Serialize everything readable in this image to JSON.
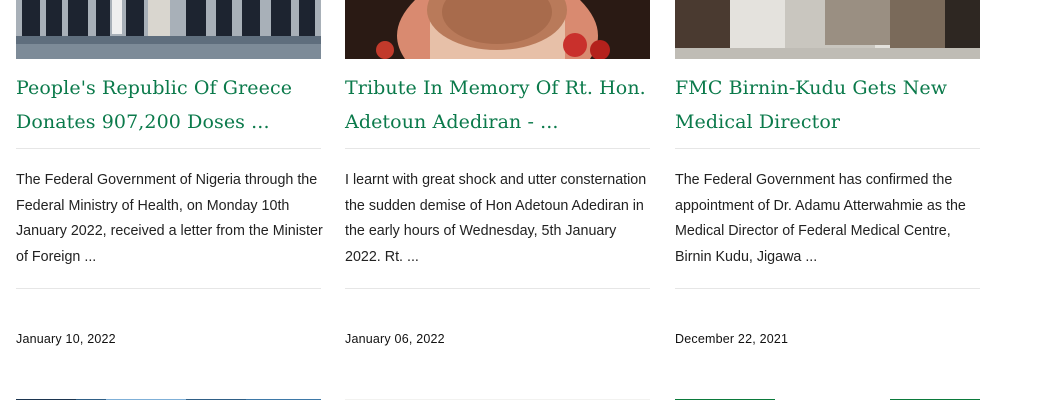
{
  "articles": [
    {
      "title": "People's Republic Of Greece Donates 907,200 Doses ...",
      "excerpt": "The Federal Government of Nigeria through the Federal Ministry of Health, on Monday 10th January 2022, received a letter from the Minister of Foreign ...",
      "date": "January 10, 2022"
    },
    {
      "title": "Tribute In Memory Of Rt. Hon. Adetoun Adediran - ...",
      "excerpt": "I learnt with great shock and utter consternation the sudden demise of Hon Adetoun Adediran in the early hours of Wednesday, 5th January 2022. Rt. ...",
      "date": "January 06, 2022"
    },
    {
      "title": "FMC Birnin-Kudu Gets New Medical Director",
      "excerpt": "The Federal Government has confirmed the appointment of Dr. Adamu Atterwahmie as the Medical Director of Federal Medical Centre, Birnin Kudu, Jigawa ...",
      "date": "December 22, 2021"
    }
  ],
  "colors": {
    "title": "#0b7a4b",
    "separator": "#e6e6e6",
    "text": "#222222"
  }
}
